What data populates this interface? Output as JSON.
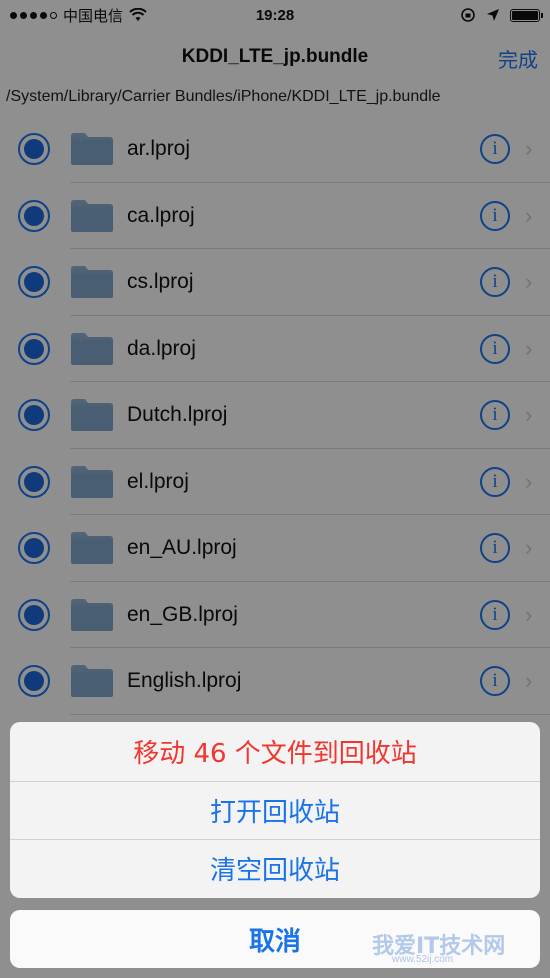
{
  "status_bar": {
    "carrier": "中国电信",
    "time": "19:28"
  },
  "nav": {
    "title": "KDDI_LTE_jp.bundle",
    "done_label": "完成"
  },
  "path": "/System/Library/Carrier Bundles/iPhone/KDDI_LTE_jp.bundle",
  "files": [
    {
      "name": "ar.lproj",
      "selected": true
    },
    {
      "name": "ca.lproj",
      "selected": true
    },
    {
      "name": "cs.lproj",
      "selected": true
    },
    {
      "name": "da.lproj",
      "selected": true
    },
    {
      "name": "Dutch.lproj",
      "selected": true
    },
    {
      "name": "el.lproj",
      "selected": true
    },
    {
      "name": "en_AU.lproj",
      "selected": true
    },
    {
      "name": "en_GB.lproj",
      "selected": true
    },
    {
      "name": "English.lproj",
      "selected": true
    }
  ],
  "action_sheet": {
    "move_label": "移动 46 个文件到回收站",
    "open_trash_label": "打开回收站",
    "empty_trash_label": "清空回收站",
    "cancel_label": "取消"
  },
  "watermark": {
    "text": "我爱IT技术网",
    "sub": "www.52ij.com"
  },
  "colors": {
    "accent": "#1a73e8",
    "destructive": "#f0362f"
  }
}
